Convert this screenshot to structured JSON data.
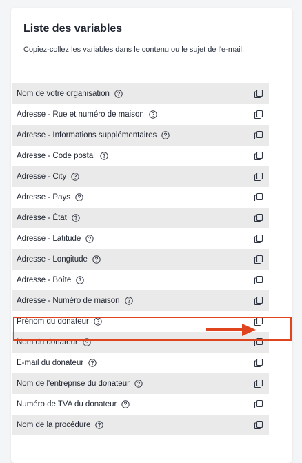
{
  "panel": {
    "title": "Liste des variables",
    "subtitle": "Copiez-collez les variables dans le contenu ou le sujet de l'e-mail."
  },
  "variables": [
    {
      "label": "Nom de votre organisation"
    },
    {
      "label": "Adresse - Rue et numéro de maison"
    },
    {
      "label": "Adresse - Informations supplémentaires"
    },
    {
      "label": "Adresse - Code postal"
    },
    {
      "label": "Adresse - City"
    },
    {
      "label": "Adresse - Pays"
    },
    {
      "label": "Adresse - État"
    },
    {
      "label": "Adresse - Latitude"
    },
    {
      "label": "Adresse - Longitude"
    },
    {
      "label": "Adresse - Boîte"
    },
    {
      "label": "Adresse - Numéro de maison"
    },
    {
      "label": "Prénom du donateur"
    },
    {
      "label": "Nom du donateur"
    },
    {
      "label": "E-mail du donateur"
    },
    {
      "label": "Nom de l'entreprise du donateur"
    },
    {
      "label": "Numéro de TVA du donateur"
    },
    {
      "label": "Nom de la procédure"
    }
  ],
  "icons": {
    "help": "question-circle-icon",
    "copy": "copy-icon"
  },
  "annotation": {
    "highlighted_row": "Prénom du donateur",
    "color": "#e0441e"
  }
}
